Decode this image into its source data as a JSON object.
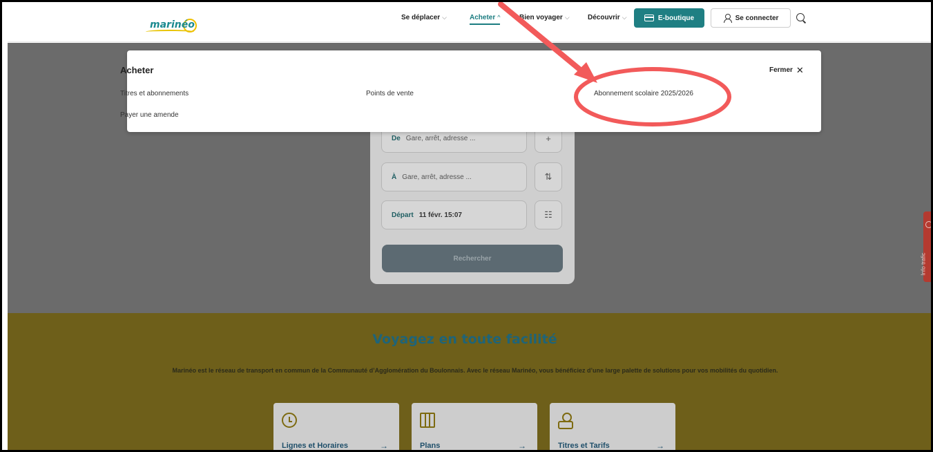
{
  "logo": {
    "text": "marinéo"
  },
  "nav": {
    "items": [
      {
        "label": "Se déplacer",
        "chevron": "⌵"
      },
      {
        "label": "Acheter",
        "chevron": "^"
      },
      {
        "label": "Bien voyager",
        "chevron": "⌵"
      },
      {
        "label": "Découvrir",
        "chevron": "⌵"
      }
    ],
    "eboutique": "E-boutique",
    "connect": "Se connecter"
  },
  "dropdown": {
    "title": "Acheter",
    "close_label": "Fermer",
    "close_glyph": "✕",
    "links": {
      "titres": "Titres et abonnements",
      "amende": "Payer une amende",
      "points": "Points de vente",
      "abonnement": "Abonnement scolaire 2025/2026"
    }
  },
  "itinerary": {
    "from_label": "De",
    "from_placeholder": "Gare, arrêt, adresse ...",
    "to_label": "À",
    "to_placeholder": "Gare, arrêt, adresse ...",
    "depart_label": "Départ",
    "depart_value": "11 févr. 15:07",
    "add_glyph": "+",
    "swap_glyph": "⇅",
    "options_glyph": "☷",
    "search_button": "Rechercher"
  },
  "side_tab": {
    "label": "Info trafic"
  },
  "promo": {
    "title": "Voyagez en toute facilité",
    "desc": "Marinéo est le réseau de transport en commun de la Communauté d’Agglomération du Boulonnais. Avec le réseau Marinéo, vous bénéficiez d’une large palette de solutions pour vos mobilités du quotidien.",
    "tiles": [
      {
        "label": "Lignes et Horaires",
        "arrow": "→",
        "icon": "clock-icon"
      },
      {
        "label": "Plans",
        "arrow": "→",
        "icon": "map-icon"
      },
      {
        "label": "Titres et Tarifs",
        "arrow": "→",
        "icon": "tickets-icon"
      }
    ]
  },
  "colors": {
    "accent": "#1f7f83",
    "highlight": "#f25a5a",
    "band": "#6e5f1a",
    "overlay": "#6b6b6b"
  }
}
